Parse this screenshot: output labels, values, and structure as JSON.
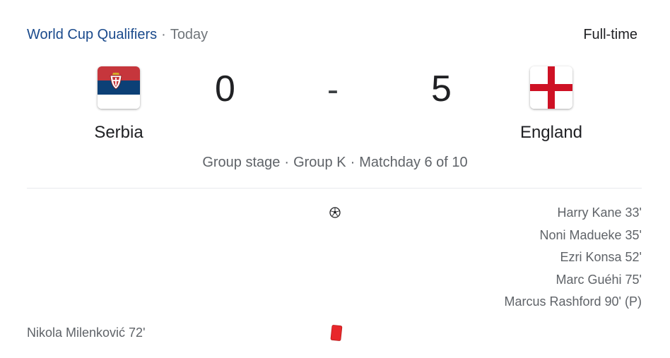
{
  "header": {
    "competition": "World Cup Qualifiers",
    "separator": "·",
    "date": "Today",
    "status": "Full-time"
  },
  "home": {
    "name": "Serbia",
    "score": "0",
    "flag_icon": "serbia-flag-icon",
    "colors": {
      "red": "#c6363c",
      "blue": "#0c4076",
      "white": "#ffffff"
    }
  },
  "away": {
    "name": "England",
    "score": "5",
    "flag_icon": "england-flag-icon",
    "colors": {
      "red": "#ce1124",
      "white": "#ffffff"
    }
  },
  "score_separator": "-",
  "meta": {
    "stage": "Group stage",
    "group": "Group K",
    "matchday": "Matchday 6 of 10",
    "separator": "·"
  },
  "events": {
    "goal_icon": "soccer-ball-icon",
    "away_goals": [
      "Harry Kane 33'",
      "Noni Madueke 35'",
      "Ezri Konsa 52'",
      "Marc Guéhi 75'",
      "Marcus Rashford 90' (P)"
    ],
    "red_card_icon": "red-card-icon",
    "red_card_color": "#e8272b",
    "home_red_card": "Nikola Milenković 72'"
  },
  "colors": {
    "link": "#1a4a8c",
    "text": "#202124",
    "secondary": "#5f6368"
  }
}
